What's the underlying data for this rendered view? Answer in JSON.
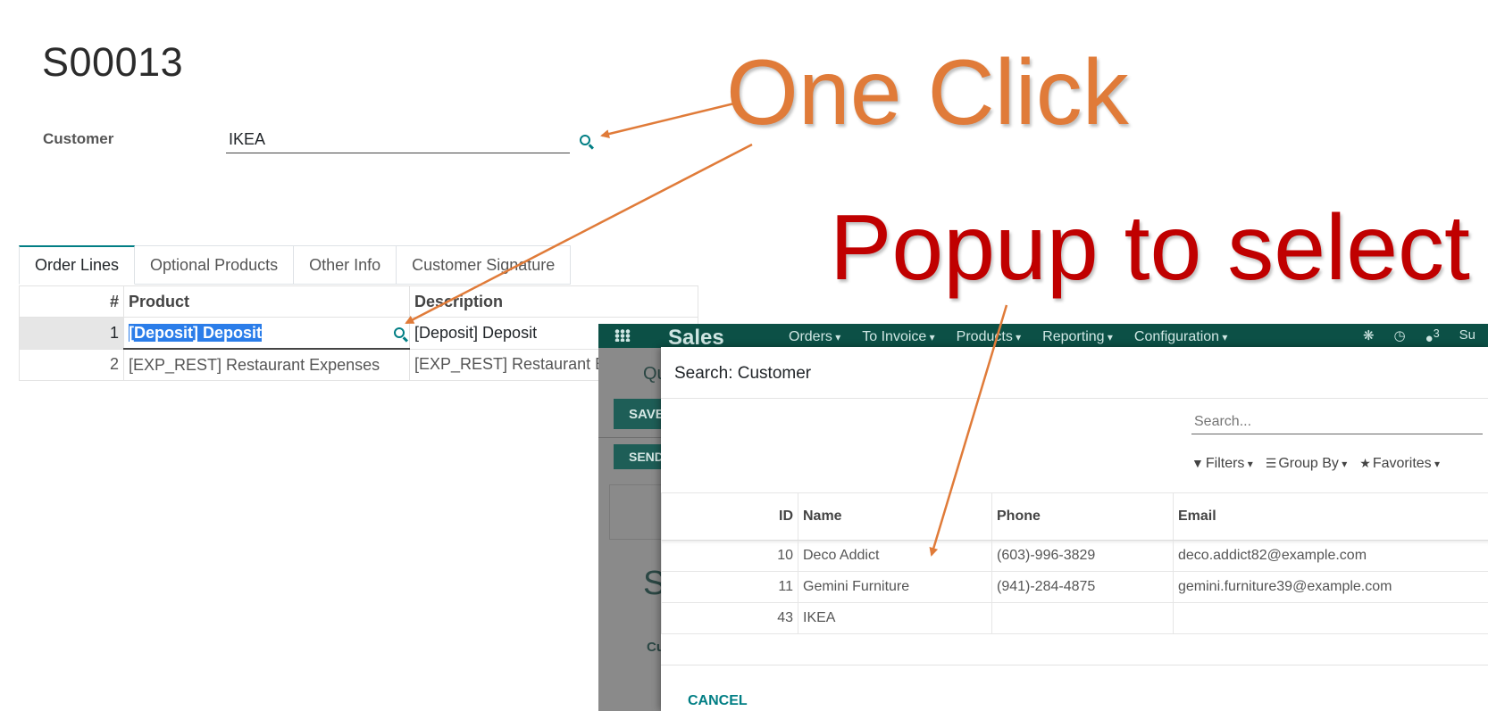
{
  "form": {
    "record_title": "S00013",
    "customer_label": "Customer",
    "customer_value": "IKEA",
    "search_icon": "search-icon"
  },
  "tabs": [
    {
      "label": "Order Lines",
      "active": true
    },
    {
      "label": "Optional Products",
      "active": false
    },
    {
      "label": "Other Info",
      "active": false
    },
    {
      "label": "Customer Signature",
      "active": false
    }
  ],
  "order_table": {
    "headers": [
      "#",
      "Product",
      "Description"
    ],
    "rows": [
      {
        "num": "1",
        "product": "[Deposit] Deposit",
        "description": "[Deposit] Deposit"
      },
      {
        "num": "2",
        "product": "[EXP_REST] Restaurant Expenses",
        "description": "[EXP_REST] Restaurant Expenses"
      }
    ]
  },
  "background_app": {
    "brand": "Sales",
    "menu": [
      "Orders",
      "To Invoice",
      "Products",
      "Reporting",
      "Configuration"
    ],
    "notification_count": "3",
    "user_initials": "Su",
    "breadcrumb": "Qu",
    "save_label": "SAVE",
    "send_label": "SEND",
    "title_fragment": "S",
    "label_fragment": "Cu"
  },
  "dialog": {
    "title": "Search: Customer",
    "search_placeholder": "Search...",
    "filters_label": "Filters",
    "groupby_label": "Group By",
    "favorites_label": "Favorites",
    "headers": [
      "ID",
      "Name",
      "Phone",
      "Email"
    ],
    "rows": [
      {
        "id": "10",
        "name": "Deco Addict",
        "phone": "(603)-996-3829",
        "email": "deco.addict82@example.com"
      },
      {
        "id": "11",
        "name": "Gemini Furniture",
        "phone": "(941)-284-4875",
        "email": "gemini.furniture39@example.com"
      },
      {
        "id": "43",
        "name": "IKEA",
        "phone": "",
        "email": ""
      }
    ],
    "cancel_label": "CANCEL"
  },
  "callouts": {
    "one_click": "One Click",
    "popup": "Popup to select"
  },
  "colors": {
    "odoo_teal": "#017e84",
    "navbar": "#0c5046",
    "callout_orange": "#e07b39",
    "callout_red": "#c00000",
    "selection_blue": "#2b7de9"
  }
}
